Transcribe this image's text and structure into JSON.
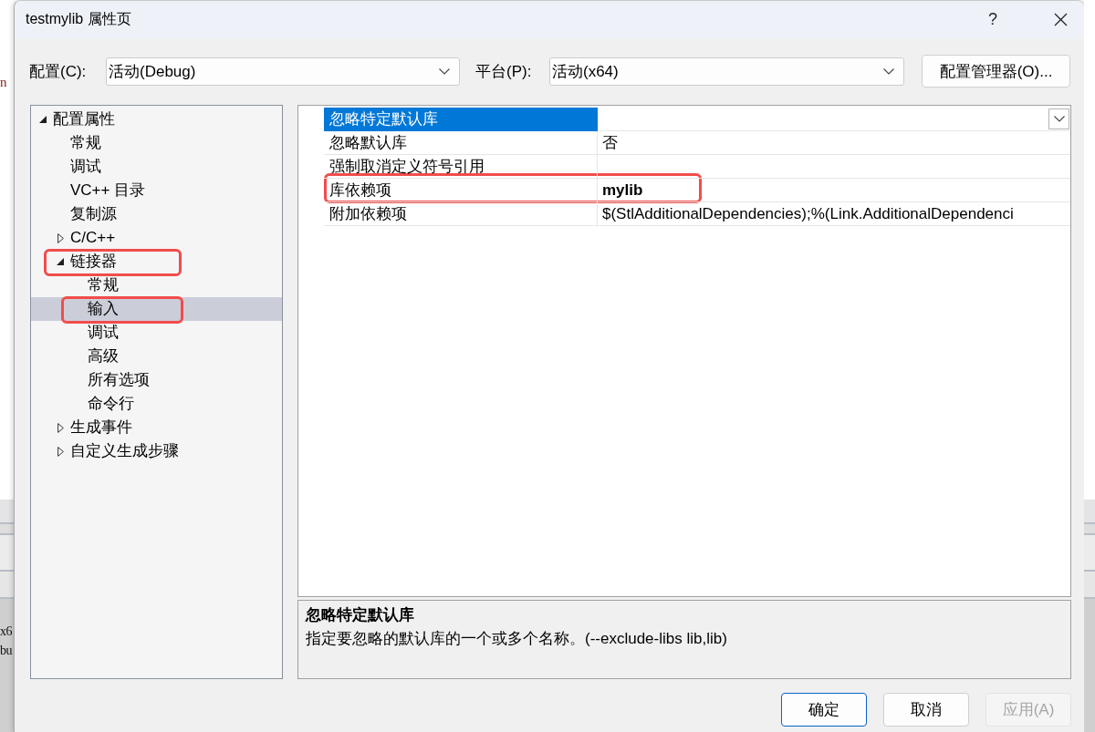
{
  "background_window": {
    "fragments": [
      "n",
      "x6",
      "bu"
    ]
  },
  "window": {
    "title": "testmylib 属性页",
    "help_button": "?"
  },
  "config_bar": {
    "configuration_label": "配置(C):",
    "configuration_value": "活动(Debug)",
    "platform_label": "平台(P):",
    "platform_value": "活动(x64)",
    "manager_button": "配置管理器(O)..."
  },
  "tree": {
    "items": [
      {
        "label": "配置属性",
        "expanded": true,
        "selected": false,
        "annotated": false,
        "children": [
          {
            "label": "常规",
            "selected": false,
            "annotated": false
          },
          {
            "label": "调试",
            "selected": false,
            "annotated": false
          },
          {
            "label": "VC++ 目录",
            "selected": false,
            "annotated": false
          },
          {
            "label": "复制源",
            "selected": false,
            "annotated": false
          },
          {
            "label": "C/C++",
            "expanded": false,
            "selected": false,
            "annotated": false
          },
          {
            "label": "链接器",
            "expanded": true,
            "selected": false,
            "annotated": true,
            "children": [
              {
                "label": "常规",
                "selected": false,
                "annotated": false
              },
              {
                "label": "输入",
                "selected": true,
                "annotated": true
              },
              {
                "label": "调试",
                "selected": false,
                "annotated": false
              },
              {
                "label": "高级",
                "selected": false,
                "annotated": false
              },
              {
                "label": "所有选项",
                "selected": false,
                "annotated": false
              },
              {
                "label": "命令行",
                "selected": false,
                "annotated": false
              }
            ]
          },
          {
            "label": "生成事件",
            "expanded": false,
            "selected": false,
            "annotated": false
          },
          {
            "label": "自定义生成步骤",
            "expanded": false,
            "selected": false,
            "annotated": false
          }
        ]
      }
    ]
  },
  "property_grid": {
    "rows": [
      {
        "name": "忽略特定默认库",
        "selected": true,
        "annotated": false
      },
      {
        "name": "忽略默认库",
        "value": "否",
        "selected": false,
        "bold": false,
        "annotated": false
      },
      {
        "name": "强制取消定义符号引用",
        "selected": false,
        "annotated": false
      },
      {
        "name": "库依赖项",
        "value": "mylib",
        "selected": false,
        "bold": true,
        "annotated": true
      },
      {
        "name": "附加依赖项",
        "value": "$(StlAdditionalDependencies);%(Link.AdditionalDependenci",
        "selected": false,
        "bold": false,
        "annotated": false
      }
    ]
  },
  "description": {
    "title": "忽略特定默认库",
    "text": "指定要忽略的默认库的一个或多个名称。(--exclude-libs lib,lib)"
  },
  "buttons": [
    {
      "label": "确定",
      "default": true,
      "disabled": false
    },
    {
      "label": "取消",
      "default": false,
      "disabled": false
    },
    {
      "label": "应用(A)",
      "default": false,
      "disabled": true
    }
  ]
}
